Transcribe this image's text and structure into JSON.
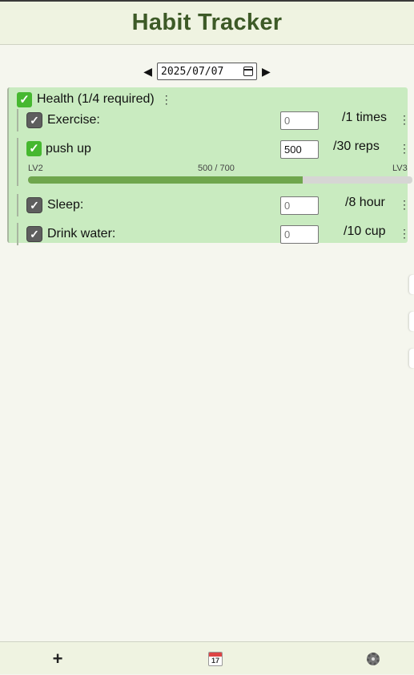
{
  "app": {
    "title": "Habit Tracker"
  },
  "date_nav": {
    "value": "2025/07/07",
    "prev_icon": "triangle-left-icon",
    "next_icon": "triangle-right-icon"
  },
  "group": {
    "title": "Health (1/4 required)",
    "checked": true,
    "menu_glyph": "⋮",
    "items": [
      {
        "label": "Exercise:",
        "value": "0",
        "value_is_placeholder": true,
        "target": "/1 times",
        "checked": true,
        "check_style": "gray"
      },
      {
        "label": "push up",
        "value": "500",
        "value_is_placeholder": false,
        "target": "/30 reps",
        "checked": true,
        "check_style": "green",
        "level": {
          "current": "LV2",
          "next": "LV3",
          "progress_text": "500 / 700",
          "progress": 500,
          "max": 700
        }
      },
      {
        "label": "Sleep:",
        "value": "0",
        "value_is_placeholder": true,
        "target": "/8 hour",
        "checked": true,
        "check_style": "gray"
      },
      {
        "label": "Drink water:",
        "value": "0",
        "value_is_placeholder": true,
        "target": "/10 cup",
        "checked": true,
        "check_style": "gray"
      }
    ]
  },
  "footer": {
    "add_label": "+",
    "calendar_day": "17",
    "icons": [
      "plus-icon",
      "calendar-icon",
      "gear-icon"
    ]
  },
  "colors": {
    "title": "#3d5a27",
    "group_bg": "#c9ebc0",
    "progress_fill": "#6fa64d",
    "check_green": "#46b830"
  }
}
